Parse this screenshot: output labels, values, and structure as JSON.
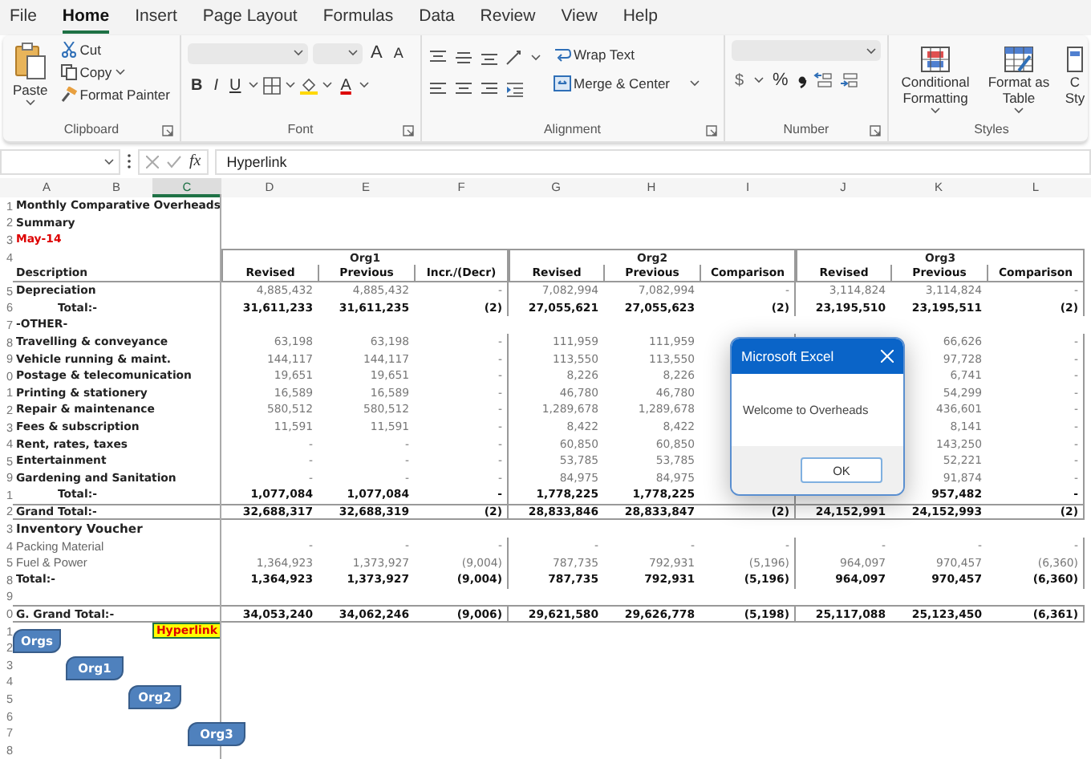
{
  "menu_tabs": [
    {
      "label": "File",
      "selected": false
    },
    {
      "label": "Home",
      "selected": true
    },
    {
      "label": "Insert",
      "selected": false
    },
    {
      "label": "Page Layout",
      "selected": false
    },
    {
      "label": "Formulas",
      "selected": false
    },
    {
      "label": "Data",
      "selected": false
    },
    {
      "label": "Review",
      "selected": false
    },
    {
      "label": "View",
      "selected": false
    },
    {
      "label": "Help",
      "selected": false
    }
  ],
  "ribbon": {
    "clipboard": {
      "paste": "Paste",
      "cut": "Cut",
      "copy": "Copy",
      "format_painter": "Format Painter",
      "label": "Clipboard"
    },
    "font": {
      "font_name_disabled": true,
      "font_size_disabled": true,
      "size_buttons": [
        "A",
        "A"
      ],
      "style_buttons": [
        "B",
        "I",
        "U"
      ],
      "font_color": "A",
      "label": "Font"
    },
    "alignment": {
      "wrap_text": "Wrap Text",
      "merge_center": "Merge & Center",
      "label": "Alignment"
    },
    "number": {
      "format_disabled": true,
      "currency": "$",
      "percent": "%",
      "label": "Number"
    },
    "styles": {
      "buttons": [
        {
          "label": "Conditional Formatting",
          "kind": "conditional"
        },
        {
          "label": "Format as Table",
          "kind": "table"
        },
        {
          "label": "C Sty",
          "kind": "cell"
        }
      ],
      "label": "Styles"
    }
  },
  "formula_bar": {
    "fx": "fx",
    "value": "Hyperlink"
  },
  "sheet": {
    "column_headers": [
      {
        "label": "A",
        "selected": false
      },
      {
        "label": "B",
        "selected": false
      },
      {
        "label": "C",
        "selected": true
      },
      {
        "label": "D",
        "selected": false
      },
      {
        "label": "E",
        "selected": false
      },
      {
        "label": "F",
        "selected": false
      },
      {
        "label": "G",
        "selected": false
      },
      {
        "label": "H",
        "selected": false
      },
      {
        "label": "I",
        "selected": false
      },
      {
        "label": "J",
        "selected": false
      },
      {
        "label": "K",
        "selected": false
      },
      {
        "label": "L",
        "selected": false
      }
    ],
    "rows": [
      {
        "row_number": "1",
        "kind": "title",
        "label": "Monthly Comparative Overheads"
      },
      {
        "row_number": "2",
        "kind": "title",
        "label": "Summary"
      },
      {
        "row_number": "3",
        "kind": "date",
        "label": "May-14"
      },
      {
        "row_number": "4",
        "kind": "groups",
        "groups": [
          "Org1",
          "Org2",
          "Org3"
        ]
      },
      {
        "kind": "header",
        "label": "Description",
        "values": [
          "Revised",
          "Previous",
          "Incr./(Decr)",
          "Revised",
          "Previous",
          "Comparison",
          "Revised",
          "Previous",
          "Comparison"
        ]
      },
      {
        "row_number": "5",
        "kind": "item",
        "label": "Depreciation",
        "cells": {
          "D": "4,885,432",
          "E": "4,885,432",
          "F": "-",
          "G": "7,082,994",
          "H": "7,082,994",
          "I": "-",
          "J": "3,114,824",
          "K": "3,114,824",
          "L": "-"
        }
      },
      {
        "row_number": "6",
        "kind": "total",
        "label": "Total:-",
        "cells": {
          "D": "31,611,233",
          "E": "31,611,235",
          "F": "(2)",
          "G": "27,055,621",
          "H": "27,055,623",
          "I": "(2)",
          "J": "23,195,510",
          "K": "23,195,511",
          "L": "(2)"
        }
      },
      {
        "row_number": "7",
        "kind": "section",
        "label": "-OTHER-"
      },
      {
        "row_number": "8",
        "kind": "item",
        "label": "Travelling & conveyance",
        "cells": {
          "D": "63,198",
          "E": "63,198",
          "F": "-",
          "G": "111,959",
          "H": "111,959",
          "K": "66,626",
          "L": "-"
        }
      },
      {
        "row_number": "9",
        "kind": "item",
        "label": "Vehicle running & maint.",
        "cells": {
          "D": "144,117",
          "E": "144,117",
          "F": "-",
          "G": "113,550",
          "H": "113,550",
          "K": "97,728",
          "L": "-"
        }
      },
      {
        "row_number": "0",
        "kind": "item",
        "label": "Postage & telecomunication",
        "cells": {
          "D": "19,651",
          "E": "19,651",
          "F": "-",
          "G": "8,226",
          "H": "8,226",
          "K": "6,741",
          "L": "-"
        }
      },
      {
        "row_number": "1",
        "kind": "item",
        "label": "Printing & stationery",
        "cells": {
          "D": "16,589",
          "E": "16,589",
          "F": "-",
          "G": "46,780",
          "H": "46,780",
          "K": "54,299",
          "L": "-"
        }
      },
      {
        "row_number": "2",
        "kind": "item",
        "label": "Repair & maintenance",
        "cells": {
          "D": "580,512",
          "E": "580,512",
          "F": "-",
          "G": "1,289,678",
          "H": "1,289,678",
          "K": "436,601",
          "L": "-"
        }
      },
      {
        "row_number": "3",
        "kind": "item",
        "label": "Fees & subscription",
        "cells": {
          "D": "11,591",
          "E": "11,591",
          "F": "-",
          "G": "8,422",
          "H": "8,422",
          "K": "8,141",
          "L": "-"
        }
      },
      {
        "row_number": "4",
        "kind": "item",
        "label": "Rent, rates, taxes",
        "cells": {
          "D": "-",
          "E": "-",
          "F": "-",
          "G": "60,850",
          "H": "60,850",
          "K": "143,250",
          "L": "-"
        }
      },
      {
        "row_number": "5",
        "kind": "item",
        "label": "Entertainment",
        "cells": {
          "D": "-",
          "E": "-",
          "F": "-",
          "G": "53,785",
          "H": "53,785",
          "K": "52,221",
          "L": "-"
        }
      },
      {
        "row_number": "9",
        "kind": "item",
        "label": "Gardening and Sanitation",
        "cells": {
          "D": "-",
          "E": "-",
          "F": "-",
          "G": "84,975",
          "H": "84,975",
          "K": "91,874",
          "L": "-"
        }
      },
      {
        "row_number": "1",
        "kind": "total",
        "label": "Total:-",
        "cells": {
          "D": "1,077,084",
          "E": "1,077,084",
          "F": "-",
          "G": "1,778,225",
          "H": "1,778,225",
          "K": "957,482",
          "L": "-"
        }
      },
      {
        "row_number": "2",
        "kind": "grand",
        "label": "Grand Total:-",
        "cells": {
          "D": "32,688,317",
          "E": "32,688,319",
          "F": "(2)",
          "G": "28,833,846",
          "H": "28,833,847",
          "I": "(2)",
          "J": "24,152,991",
          "K": "24,152,993",
          "L": "(2)"
        }
      },
      {
        "row_number": "3",
        "kind": "section",
        "label": "Inventory Voucher"
      },
      {
        "row_number": "4",
        "kind": "plain",
        "label": "Packing Material",
        "cells": {
          "D": "-",
          "E": "-",
          "F": "-",
          "G": "-",
          "H": "-",
          "I": "-",
          "J": "-",
          "K": "-",
          "L": "-"
        }
      },
      {
        "row_number": "5",
        "kind": "plain",
        "label": "Fuel & Power",
        "cells": {
          "D": "1,364,923",
          "E": "1,373,927",
          "F": "(9,004)",
          "G": "787,735",
          "H": "792,931",
          "I": "(5,196)",
          "J": "964,097",
          "K": "970,457",
          "L": "(6,360)"
        }
      },
      {
        "row_number": "8",
        "kind": "subtotal",
        "label": "Total:-",
        "cells": {
          "D": "1,364,923",
          "E": "1,373,927",
          "F": "(9,004)",
          "G": "787,735",
          "H": "792,931",
          "I": "(5,196)",
          "J": "964,097",
          "K": "970,457",
          "L": "(6,360)"
        }
      },
      {
        "row_number": "9",
        "kind": "blank"
      },
      {
        "row_number": "0",
        "kind": "grand",
        "label": "G. Grand Total:-",
        "cells": {
          "D": "34,053,240",
          "E": "34,062,246",
          "F": "(9,006)",
          "G": "29,621,580",
          "H": "29,626,778",
          "I": "(5,198)",
          "J": "25,117,088",
          "K": "25,123,450",
          "L": "(6,361)"
        }
      },
      {
        "row_number": "1",
        "kind": "link",
        "link": {
          "text": "Hyperlink",
          "selected": true
        }
      },
      {
        "row_number": "2",
        "kind": "blank"
      },
      {
        "row_number": "3",
        "kind": "blank"
      },
      {
        "row_number": "4",
        "kind": "blank"
      },
      {
        "row_number": "5",
        "kind": "blank"
      },
      {
        "row_number": "6",
        "kind": "blank"
      },
      {
        "row_number": "7",
        "kind": "blank"
      },
      {
        "row_number": "8",
        "kind": "blank"
      }
    ],
    "shapes": [
      "Orgs",
      "Org1",
      "Org2",
      "Org3"
    ]
  },
  "dialog": {
    "title": "Microsoft Excel",
    "message": "Welcome to Overheads",
    "button": "OK"
  }
}
